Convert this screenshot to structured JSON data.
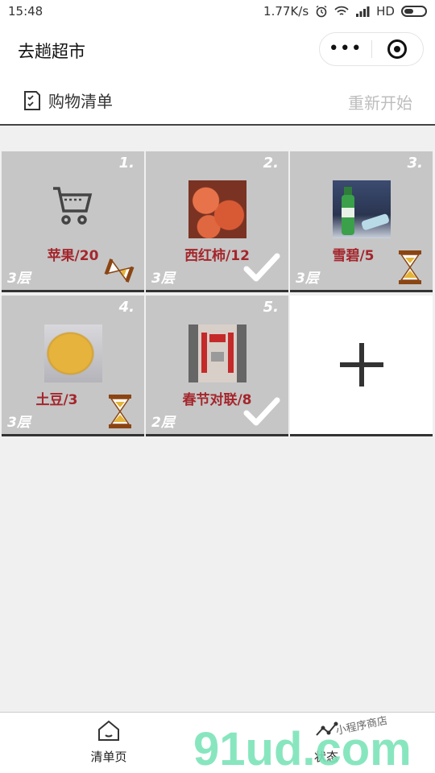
{
  "status_bar": {
    "time": "15:48",
    "speed": "1.77K/s",
    "network": "HD"
  },
  "nav": {
    "title": "去趟超市"
  },
  "header": {
    "list_title": "购物清单",
    "restart": "重新开始"
  },
  "items": [
    {
      "num": "1.",
      "label": "苹果/20",
      "floor": "3层",
      "image": "cart-icon",
      "status": "hourglass-icon"
    },
    {
      "num": "2.",
      "label": "西红柿/12",
      "floor": "3层",
      "image": "tomato-image",
      "status": "checkmark-icon"
    },
    {
      "num": "3.",
      "label": "雪碧/5",
      "floor": "3层",
      "image": "sprite-image",
      "status": "hourglass-icon"
    },
    {
      "num": "4.",
      "label": "土豆/3",
      "floor": "3层",
      "image": "potato-image",
      "status": "hourglass-icon"
    },
    {
      "num": "5.",
      "label": "春节对联/8",
      "floor": "2层",
      "image": "couplet-image",
      "status": "checkmark-icon"
    }
  ],
  "tabbar": {
    "tabs": [
      {
        "label": "清单页",
        "icon": "home-icon"
      },
      {
        "label": "状态",
        "icon": "status-icon"
      }
    ]
  },
  "watermark": {
    "text": "91ud.com",
    "subtext": "小程序商店"
  },
  "colors": {
    "label_red": "#a4262c",
    "cell_gray": "#c6c6c6",
    "watermark_green": "#7be3b8",
    "watermark_orange": "#f59b2a"
  }
}
